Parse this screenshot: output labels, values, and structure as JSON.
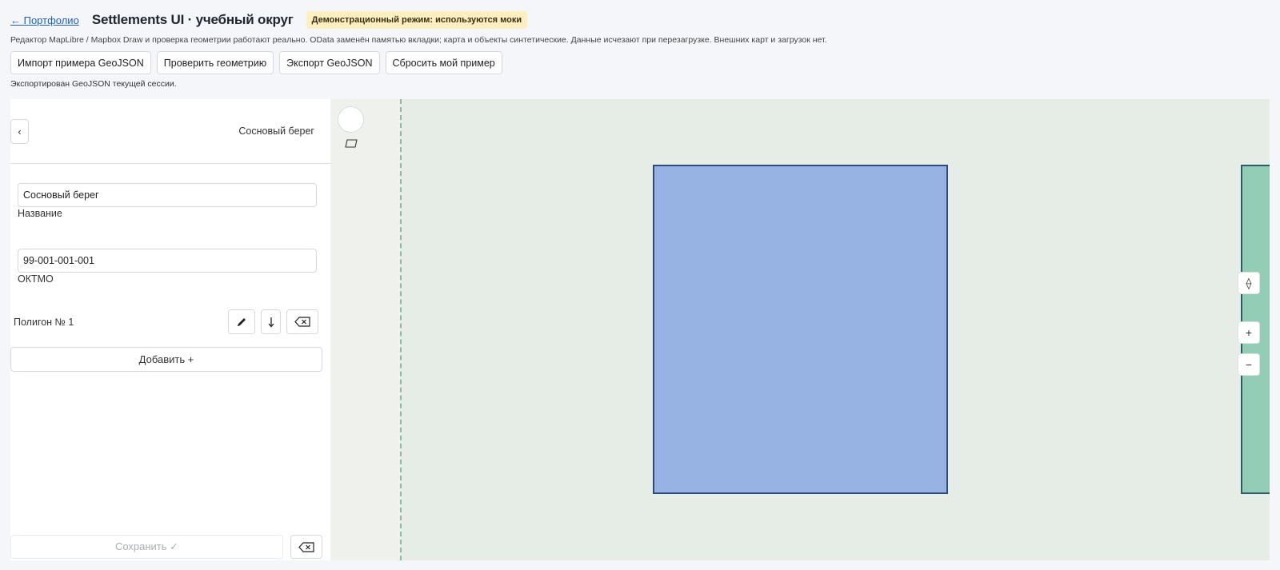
{
  "header": {
    "back_link": "← Портфолио",
    "title": "Settlements UI · учебный округ",
    "badge": "Демонстрационный режим: используются моки"
  },
  "subtitle": "Редактор MapLibre / Mapbox Draw и проверка геометрии работают реально. OData заменён памятью вкладки; карта и объекты синтетические. Данные исчезают при перезагрузке. Внешних карт и загрузок нет.",
  "toolbar": {
    "import_label": "Импорт примера GeoJSON",
    "validate_label": "Проверить геометрию",
    "export_label": "Экспорт GeoJSON",
    "reset_label": "Сбросить мой пример"
  },
  "status_message": "Экспортирован GeoJSON текущей сессии.",
  "panel": {
    "back_label": "‹",
    "title": "Сосновый берег",
    "name_value": "Сосновый берег",
    "name_label": "Название",
    "oktmo_value": "99-001-001-001",
    "oktmo_label": "ОКТМО",
    "polygon_label": "Полигон № 1",
    "add_label": "Добавить +",
    "save_label": "Сохранить ✓"
  },
  "map": {
    "compass_label": "⟠",
    "zoom_in_label": "+",
    "zoom_out_label": "−",
    "colors": {
      "background": "#e5ede6",
      "selected_fill": "#97b3e3",
      "selected_stroke": "#2e4b73",
      "other_fill": "#94cdb6"
    }
  },
  "icons": {
    "edit": "pencil-icon",
    "move_down": "arrow-down-icon",
    "delete": "backspace-icon",
    "draw_point": "circle-draw-icon",
    "draw_polygon": "polygon-draw-icon"
  }
}
